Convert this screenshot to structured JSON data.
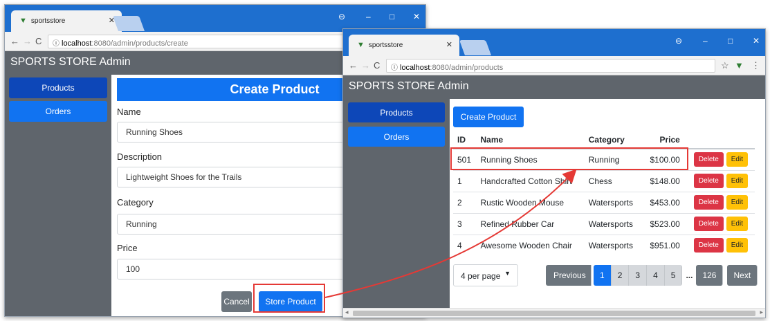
{
  "window1": {
    "tab_title": "sportsstore",
    "url_host": "localhost",
    "url_path": ":8080/admin/products/create",
    "app_title": "SPORTS STORE Admin",
    "sidebar": [
      "Products",
      "Orders"
    ],
    "form": {
      "title": "Create Product",
      "fields": [
        {
          "label": "Name",
          "value": "Running Shoes"
        },
        {
          "label": "Description",
          "value": "Lightweight Shoes for the Trails"
        },
        {
          "label": "Category",
          "value": "Running"
        },
        {
          "label": "Price",
          "value": "100"
        }
      ],
      "cancel_label": "Cancel",
      "store_label": "Store Product"
    }
  },
  "window2": {
    "tab_title": "sportsstore",
    "url_host": "localhost",
    "url_path": ":8080/admin/products",
    "app_title": "SPORTS STORE Admin",
    "sidebar": [
      "Products",
      "Orders"
    ],
    "create_button": "Create Product",
    "columns": [
      "ID",
      "Name",
      "Category",
      "Price"
    ],
    "rows": [
      {
        "id": "501",
        "name": "Running Shoes",
        "category": "Running",
        "price": "$100.00"
      },
      {
        "id": "1",
        "name": "Handcrafted Cotton Shirt",
        "category": "Chess",
        "price": "$148.00"
      },
      {
        "id": "2",
        "name": "Rustic Wooden Mouse",
        "category": "Watersports",
        "price": "$453.00"
      },
      {
        "id": "3",
        "name": "Refined Rubber Car",
        "category": "Watersports",
        "price": "$523.00"
      },
      {
        "id": "4",
        "name": "Awesome Wooden Chair",
        "category": "Watersports",
        "price": "$951.00"
      }
    ],
    "delete_label": "Delete",
    "edit_label": "Edit",
    "page_size": "4 per page",
    "pager": {
      "previous": "Previous",
      "pages": [
        "1",
        "2",
        "3",
        "4",
        "5"
      ],
      "ellipsis": "...",
      "last": "126",
      "next": "Next"
    }
  },
  "colors": {
    "accent": "#1173f1",
    "titlebar": "#1e6fcf",
    "highlight": "#e53935",
    "delete": "#dc3545",
    "edit": "#ffc107"
  }
}
